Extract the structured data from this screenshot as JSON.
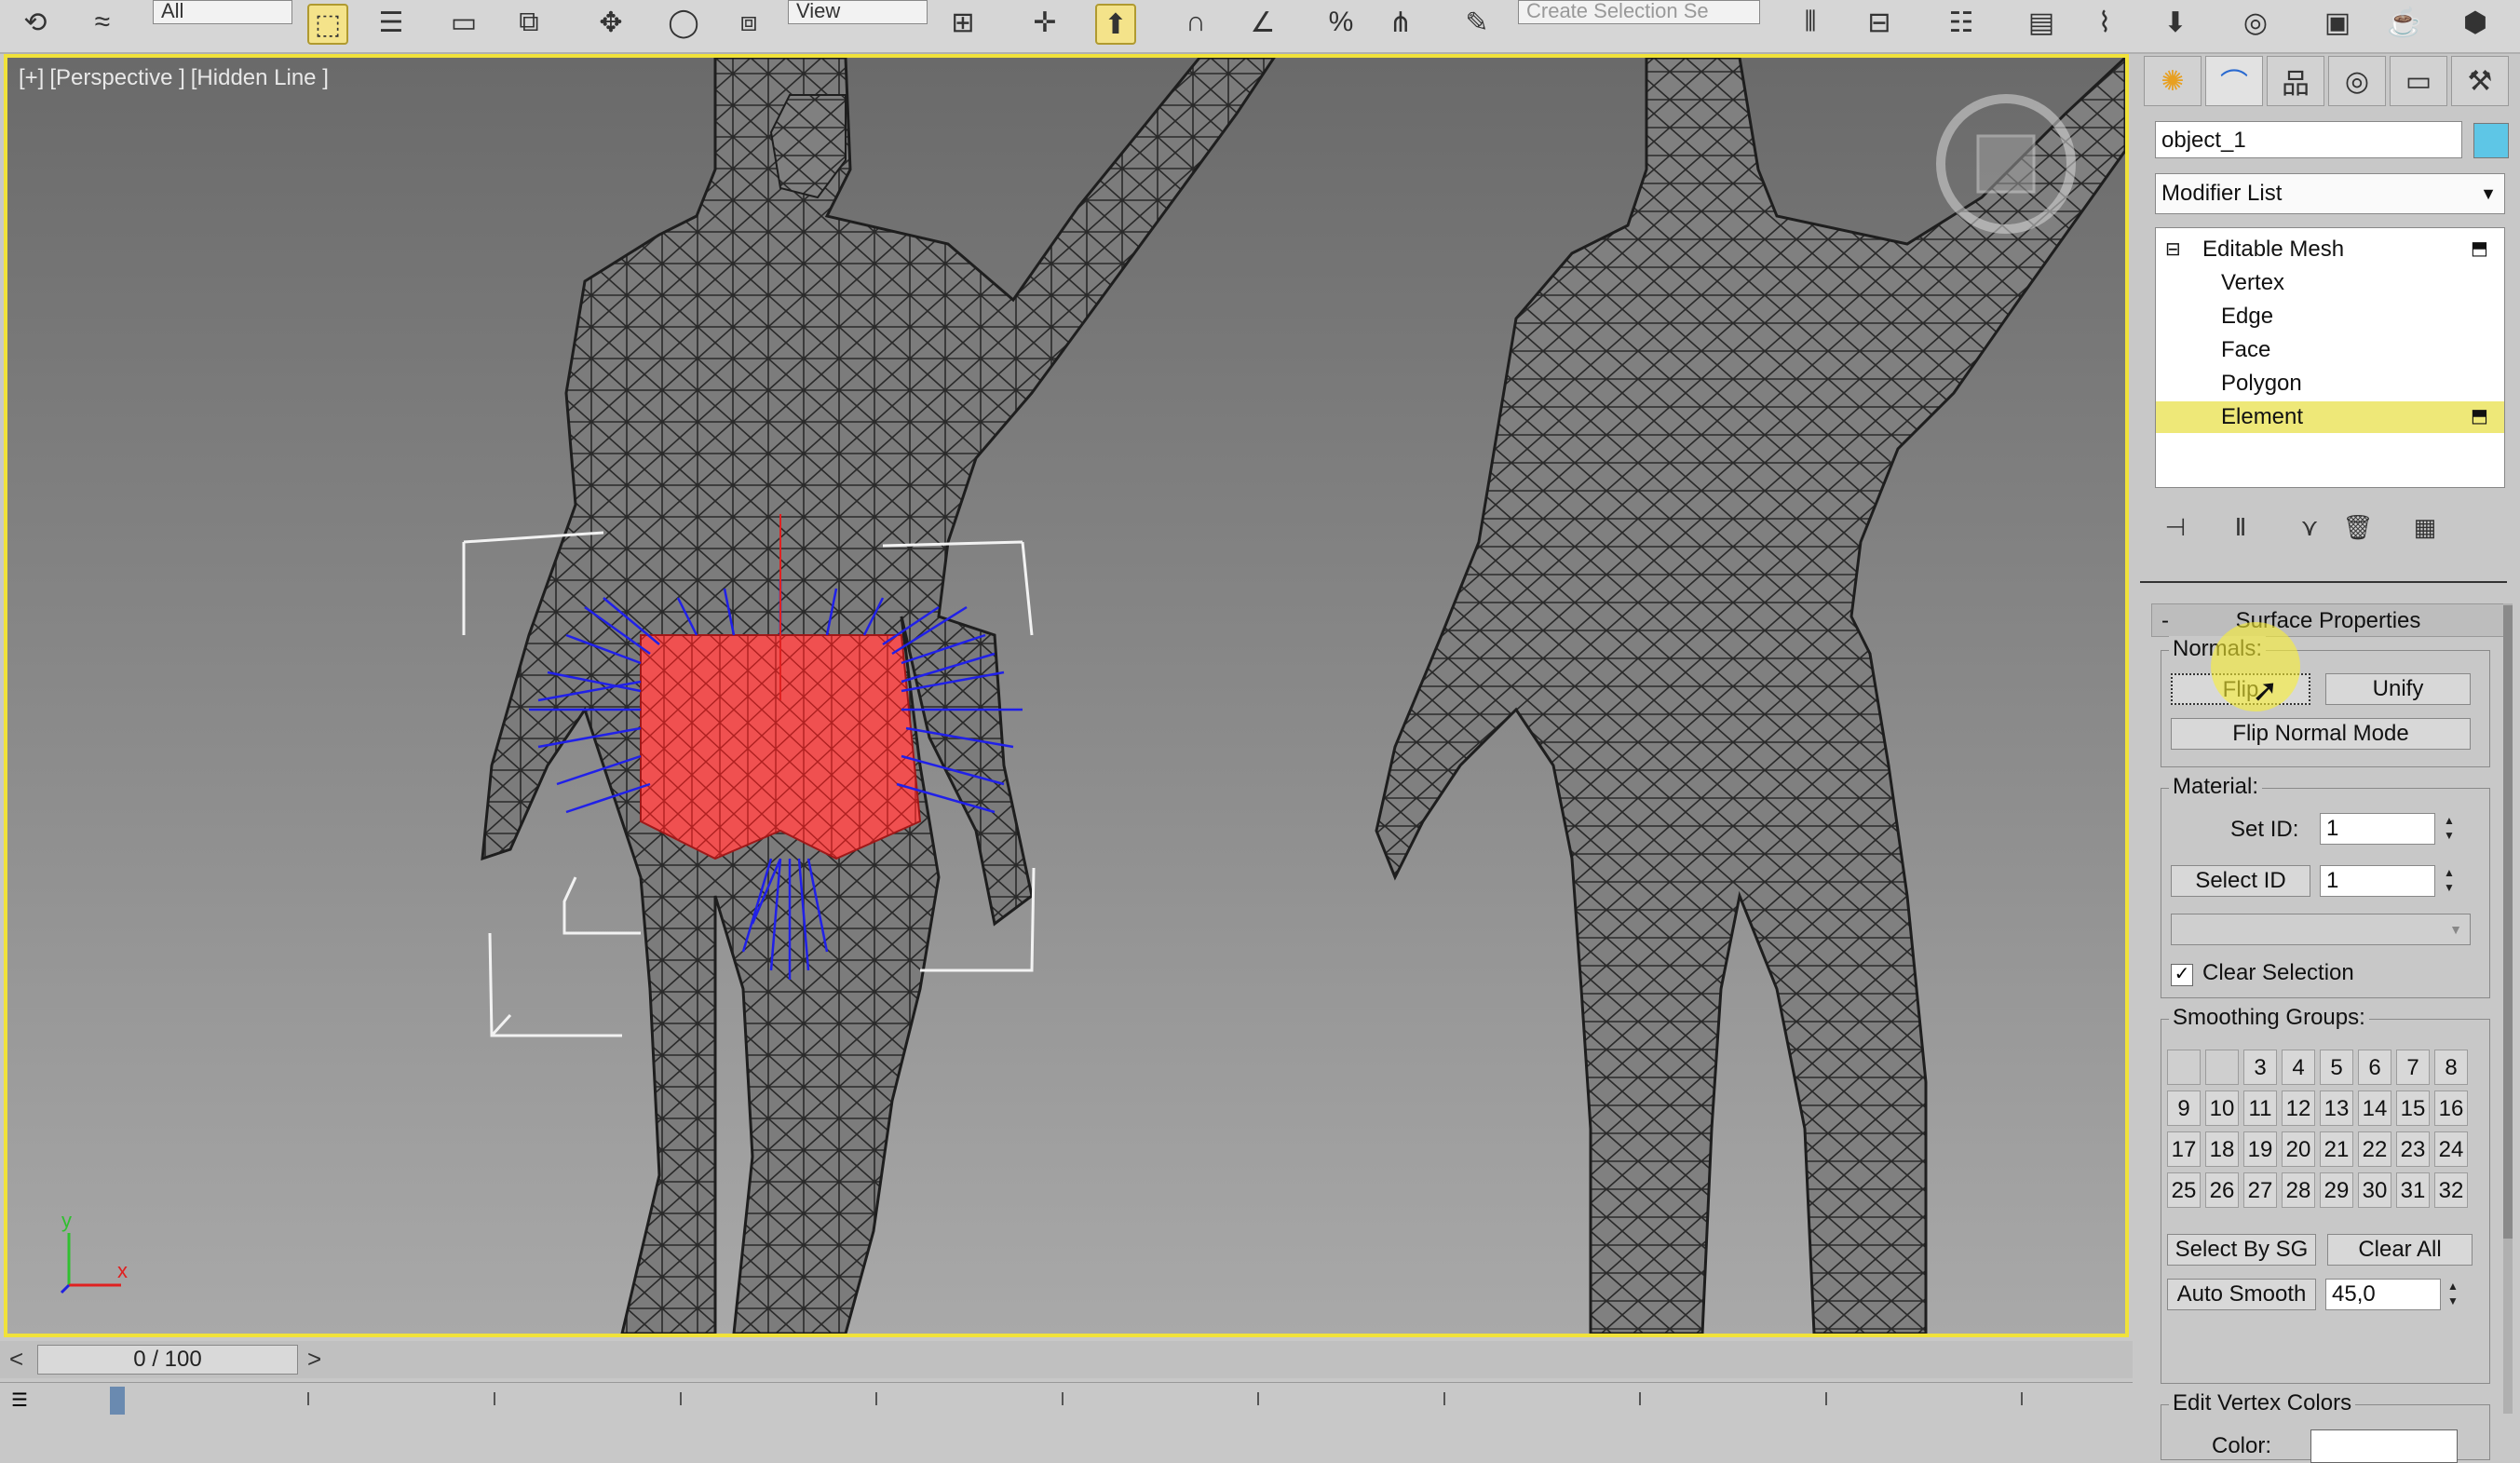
{
  "toolbar": {
    "filter_dropdown": "All",
    "view_dropdown": "View",
    "selection_set_placeholder": "Create Selection Se"
  },
  "viewport": {
    "label_plus": "[+]",
    "label_view": "[Perspective ]",
    "label_shading": "[Hidden Line ]",
    "axis_x": "x",
    "axis_y": "y"
  },
  "timeline": {
    "frame_display": "0 / 100",
    "prev_label": "<",
    "next_label": ">"
  },
  "command_panel": {
    "object_name": "object_1",
    "object_color": "#5ec6e6",
    "modifier_list": "Modifier List",
    "stack": {
      "root": "Editable Mesh",
      "sub_objects": [
        "Vertex",
        "Edge",
        "Face",
        "Polygon",
        "Element"
      ],
      "selected": "Element"
    },
    "surface_properties": {
      "title": "Surface Properties",
      "collapse_symbol": "-",
      "normals_group": "Normals:",
      "flip_button": "Flip",
      "unify_button": "Unify",
      "flip_normal_mode_button": "Flip Normal Mode",
      "material_group": "Material:",
      "set_id_label": "Set ID:",
      "set_id_value": "1",
      "select_id_button": "Select ID",
      "select_id_value": "1",
      "clear_selection_label": "Clear Selection",
      "clear_selection_checked": true,
      "smoothing_group": "Smoothing Groups:",
      "smoothing_cells": [
        "",
        "",
        "3",
        "4",
        "5",
        "6",
        "7",
        "8",
        "9",
        "10",
        "11",
        "12",
        "13",
        "14",
        "15",
        "16",
        "17",
        "18",
        "19",
        "20",
        "21",
        "22",
        "23",
        "24",
        "25",
        "26",
        "27",
        "28",
        "29",
        "30",
        "31",
        "32"
      ],
      "select_by_sg_button": "Select By SG",
      "clear_all_button": "Clear All",
      "auto_smooth_button": "Auto Smooth",
      "auto_smooth_value": "45,0",
      "edit_vertex_colors_group": "Edit Vertex Colors",
      "color_label": "Color:"
    }
  }
}
